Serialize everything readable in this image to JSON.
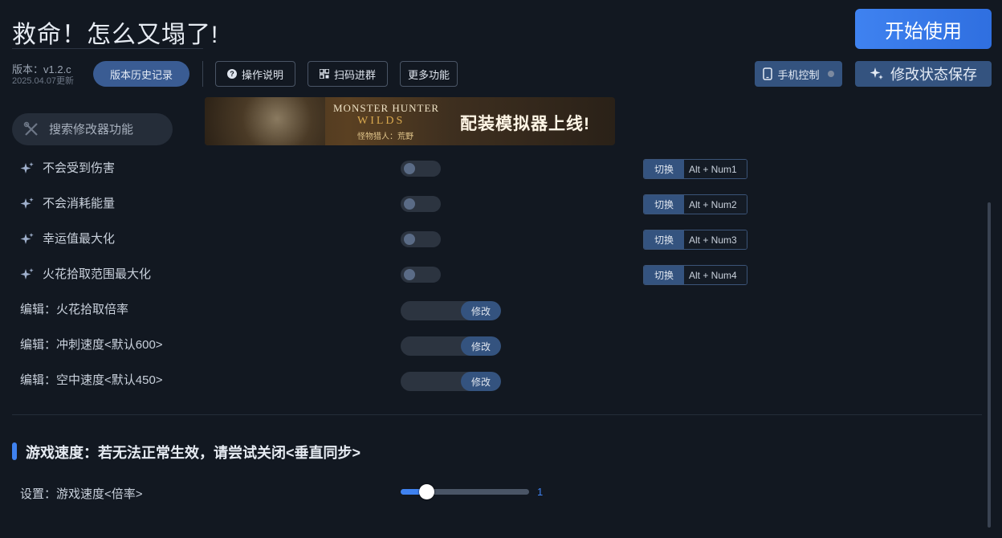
{
  "header": {
    "title": "救命！怎么又塌了!",
    "start_label": "开始使用",
    "version": "版本：v1.2.c",
    "update_date": "2025.04.07更新"
  },
  "toolbar": {
    "history_label": "版本历史记录",
    "help_label": "操作说明",
    "qr_label": "扫码进群",
    "more_label": "更多功能",
    "phone_label": "手机控制",
    "save_label": "修改状态保存"
  },
  "search": {
    "placeholder": "搜索修改器功能"
  },
  "banner": {
    "logo_line1": "MONSTER HUNTER",
    "logo_line2": "WILDS",
    "logo_line3": "怪物猎人：荒野",
    "slogan": "配装模拟器上线!"
  },
  "toggles": [
    {
      "label": "不会受到伤害",
      "switch_label": "切换",
      "hotkey": "Alt + Num1",
      "on": false
    },
    {
      "label": "不会消耗能量",
      "switch_label": "切换",
      "hotkey": "Alt + Num2",
      "on": false
    },
    {
      "label": "幸运值最大化",
      "switch_label": "切换",
      "hotkey": "Alt + Num3",
      "on": false
    },
    {
      "label": "火花拾取范围最大化",
      "switch_label": "切换",
      "hotkey": "Alt + Num4",
      "on": false
    }
  ],
  "edits": [
    {
      "label": "编辑：火花拾取倍率",
      "value": "",
      "button": "修改"
    },
    {
      "label": "编辑：冲刺速度<默认600>",
      "value": "",
      "button": "修改"
    },
    {
      "label": "编辑：空中速度<默认450>",
      "value": "",
      "button": "修改"
    }
  ],
  "section": {
    "title": "游戏速度：若无法正常生效，请尝试关闭<垂直同步>"
  },
  "speed": {
    "label": "设置：游戏速度<倍率>",
    "value": "1",
    "min": 0,
    "max": 10,
    "current": 1
  },
  "colors": {
    "accent": "#3f82f0",
    "background": "#121821",
    "button": "#34537f"
  }
}
